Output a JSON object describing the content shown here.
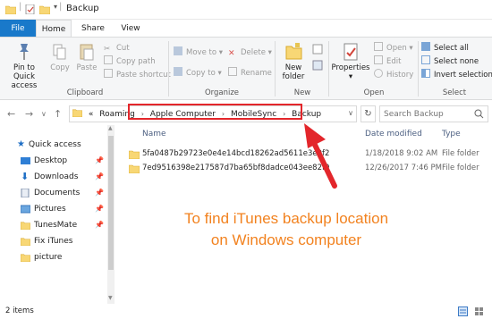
{
  "window": {
    "title": "Backup"
  },
  "tabs": [
    {
      "label": "File"
    },
    {
      "label": "Home"
    },
    {
      "label": "Share"
    },
    {
      "label": "View"
    }
  ],
  "ribbon": {
    "clipboard": {
      "pin_label_1": "Pin to Quick",
      "pin_label_2": "access",
      "copy": "Copy",
      "paste": "Paste",
      "cut": "Cut",
      "copy_path": "Copy path",
      "paste_shortcut": "Paste shortcut",
      "group": "Clipboard"
    },
    "organize": {
      "move_to": "Move to",
      "copy_to": "Copy to",
      "delete": "Delete",
      "rename": "Rename",
      "group": "Organize"
    },
    "new": {
      "new_folder_1": "New",
      "new_folder_2": "folder",
      "group": "New"
    },
    "open": {
      "properties": "Properties",
      "open": "Open",
      "edit": "Edit",
      "history": "History",
      "group": "Open"
    },
    "select": {
      "select_all": "Select all",
      "select_none": "Select none",
      "invert": "Invert selection",
      "group": "Select"
    }
  },
  "address": {
    "prefix": "«",
    "crumbs": [
      "Roaming",
      "Apple Computer",
      "MobileSync",
      "Backup"
    ],
    "search_placeholder": "Search Backup"
  },
  "sidebar": {
    "items": [
      {
        "label": "Quick access"
      },
      {
        "label": "Desktop"
      },
      {
        "label": "Downloads"
      },
      {
        "label": "Documents"
      },
      {
        "label": "Pictures"
      },
      {
        "label": "TunesMate"
      },
      {
        "label": "Fix iTunes"
      },
      {
        "label": "picture"
      }
    ]
  },
  "columns": {
    "name": "Name",
    "date": "Date modified",
    "type": "Type"
  },
  "files": [
    {
      "name": "5fa0487b29723e0e4e14bcd18262ad5611e3e9f2",
      "date": "1/18/2018 9:02 AM",
      "type": "File folder"
    },
    {
      "name": "7ed9516398e217587d7ba65bf8dadce043ee82f9",
      "date": "12/26/2017 7:46 PM",
      "type": "File folder"
    }
  ],
  "annotation": {
    "line1": "To find iTunes backup location",
    "line2": "on Windows computer",
    "color": "#f2821f"
  },
  "status": {
    "count": "2 items"
  },
  "colors": {
    "accent": "#1979ca",
    "highlight": "#e3262b",
    "folder": "#f8d775"
  }
}
